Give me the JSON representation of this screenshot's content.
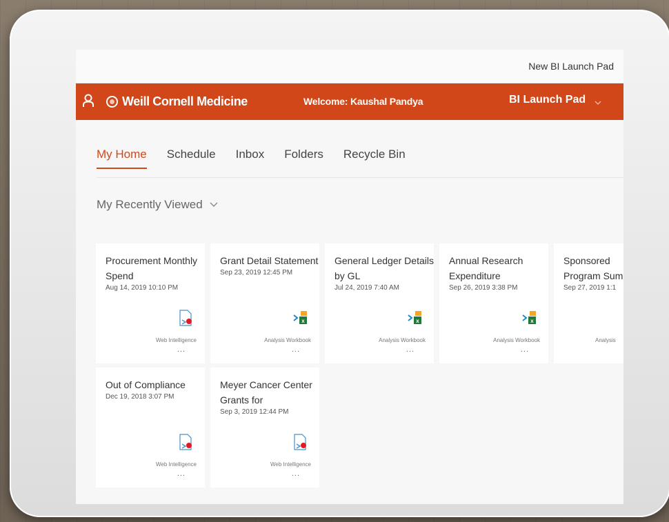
{
  "topbar": {
    "title": "New BI Launch Pad"
  },
  "header": {
    "logo": "Weill Cornell Medicine",
    "welcome": "Welcome: Kaushal Pandya",
    "launchpad": "BI Launch Pad",
    "color": "#d24719"
  },
  "tabs": [
    "My Home",
    "Schedule",
    "Inbox",
    "Folders",
    "Recycle Bin"
  ],
  "active_tab": "My Home",
  "recent": {
    "label": "My Recently Viewed"
  },
  "cards": [
    {
      "title": "Procurement Monthly Spend",
      "date": "Aug 14, 2019 10:10 PM",
      "type": "Web Intelligence",
      "icon": "web-intelligence-icon"
    },
    {
      "title": "Grant Detail Statement",
      "date": "Sep 23, 2019 12:45 PM",
      "type": "Analysis Workbook",
      "icon": "analysis-workbook-icon"
    },
    {
      "title": "General Ledger Details by GL",
      "date": "Jul 24, 2019 7:40 AM",
      "type": "Analysis Workbook",
      "icon": "analysis-workbook-icon"
    },
    {
      "title": "Annual Research Expenditure",
      "date": "Sep 26, 2019 3:38 PM",
      "type": "Analysis Workbook",
      "icon": "analysis-workbook-icon"
    },
    {
      "title": "Sponsored Program Sum",
      "date": "Sep 27, 2019 1:1",
      "type": "Analysis",
      "icon": "analysis-workbook-icon"
    },
    {
      "title": "Out of Compliance",
      "date": "Dec 19, 2018 3:07 PM",
      "type": "Web Intelligence",
      "icon": "web-intelligence-icon"
    },
    {
      "title": "Meyer Cancer Center Grants for",
      "date": "Sep 3, 2019 12:44 PM",
      "type": "Web Intelligence",
      "icon": "web-intelligence-icon"
    }
  ],
  "more_label": "..."
}
